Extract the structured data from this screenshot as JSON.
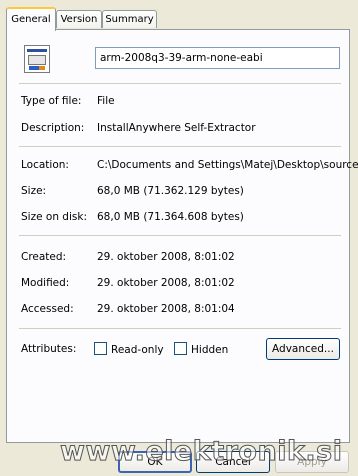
{
  "tabs": [
    {
      "label": "General"
    },
    {
      "label": "Version"
    },
    {
      "label": "Summary"
    }
  ],
  "file": {
    "icon": "installer-file-icon",
    "name": "arm-2008q3-39-arm-none-eabi"
  },
  "properties": {
    "type_label": "Type of file:",
    "type_value": "File",
    "description_label": "Description:",
    "description_value": "InstallAnywhere Self-Extractor",
    "location_label": "Location:",
    "location_value": "C:\\Documents and Settings\\Matej\\Desktop\\source",
    "size_label": "Size:",
    "size_value": "68,0 MB (71.362.129 bytes)",
    "size_on_disk_label": "Size on disk:",
    "size_on_disk_value": "68,0 MB (71.364.608 bytes)",
    "created_label": "Created:",
    "created_value": "29. oktober 2008, 8:01:02",
    "modified_label": "Modified:",
    "modified_value": "29. oktober 2008, 8:01:02",
    "accessed_label": "Accessed:",
    "accessed_value": "29. oktober 2008, 8:01:04"
  },
  "attributes": {
    "label": "Attributes:",
    "readonly_label": "Read-only",
    "readonly_checked": false,
    "hidden_label": "Hidden",
    "hidden_checked": false,
    "advanced_label": "Advanced..."
  },
  "buttons": {
    "ok": "OK",
    "cancel": "Cancel",
    "apply": "Apply"
  },
  "watermark": "www.elektronik.si",
  "colors": {
    "dialog_bg": "#ece9d8",
    "panel_bg": "#fcfcfe",
    "active_tab_accent": "#ffc83c",
    "button_border": "#003c74"
  }
}
